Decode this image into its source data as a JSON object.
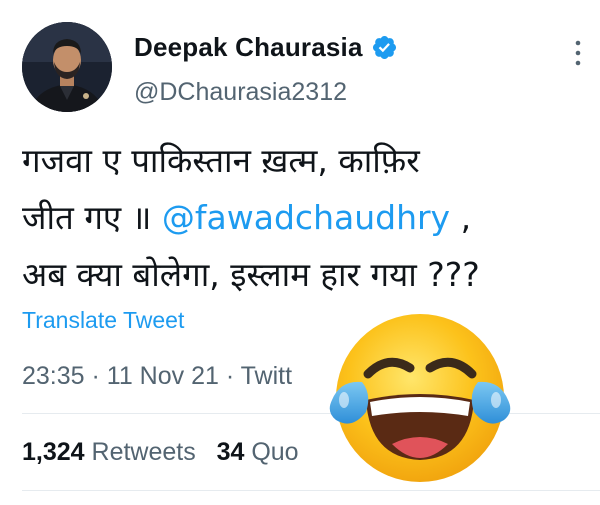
{
  "user": {
    "display_name": "Deepak Chaurasia",
    "handle": "@DChaurasia2312",
    "verified_icon": "verified-badge-icon"
  },
  "tweet": {
    "line1": "गजवा ए पाकिस्तान ख़त्म, काफ़िर",
    "line2_prefix": "जीत गए ॥ ",
    "mention": "@fawadchaudhry",
    "line2_suffix": " ,",
    "line3": "अब क्या बोलेगा, इस्लाम हार गया ???"
  },
  "translate_label": "Translate Tweet",
  "meta": {
    "time": "23:35",
    "sep1": " · ",
    "date": "11 Nov 21",
    "sep2": " · ",
    "source": "Twitt"
  },
  "stats": {
    "retweets_count": "1,324",
    "retweets_label": " Retweets",
    "quotes_count": "34",
    "quotes_label": " Quo"
  },
  "overlay": {
    "emoji": "face-with-tears-of-joy"
  },
  "colors": {
    "accent": "#1d9bf0",
    "text": "#0f1419",
    "secondary": "#536471",
    "emoji_yellow": "#fcc21b",
    "tears": "#40a8e8"
  }
}
